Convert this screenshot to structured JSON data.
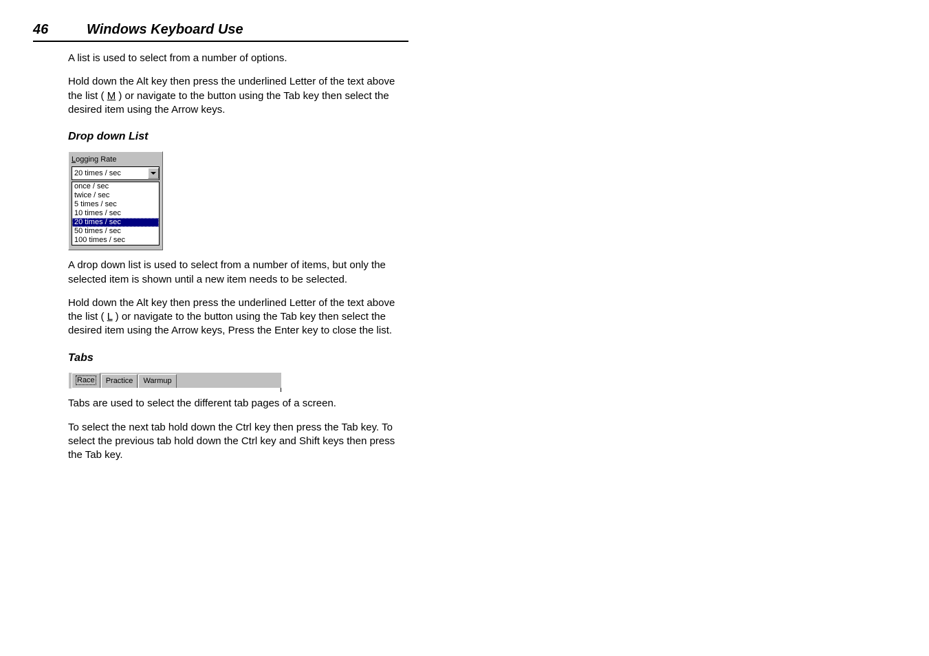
{
  "header": {
    "page_number": "46",
    "title": "Windows Keyboard Use"
  },
  "intro": {
    "p1": "A list is used to select from a number of options.",
    "p2_pre": "Hold down the Alt key then press the underlined Letter of the text above the list ( ",
    "p2_key": "M",
    "p2_post": " ) or navigate to the button using the Tab key then select the desired item using the Arrow keys."
  },
  "dropdown_section": {
    "heading": "Drop down List",
    "label_pre": "L",
    "label_post": "ogging Rate",
    "selected_value": "20 times / sec",
    "options": [
      {
        "label": "once / sec",
        "selected": false
      },
      {
        "label": "twice / sec",
        "selected": false
      },
      {
        "label": "5 times / sec",
        "selected": false
      },
      {
        "label": "10 times / sec",
        "selected": false
      },
      {
        "label": "20 times / sec",
        "selected": true
      },
      {
        "label": "50 times / sec",
        "selected": false
      },
      {
        "label": "100 times / sec",
        "selected": false
      }
    ],
    "p1": "A drop down list is used to select from a number of items, but only the selected item is shown until a new item needs to be selected.",
    "p2_pre": "Hold down the Alt key then press the underlined Letter of the text above the list ( ",
    "p2_key": "L",
    "p2_post": " ) or navigate to the button using the Tab key then select the desired item using the Arrow keys, Press the Enter key to close the list."
  },
  "tabs_section": {
    "heading": "Tabs",
    "tabs": [
      {
        "label": "Race",
        "active": true
      },
      {
        "label": "Practice",
        "active": false
      },
      {
        "label": "Warmup",
        "active": false
      }
    ],
    "p1": "Tabs are used to select the different tab pages of a screen.",
    "p2": "To select the next tab hold down the Ctrl key then press the Tab key. To select the previous tab hold down the Ctrl key and Shift keys then press the Tab key."
  }
}
